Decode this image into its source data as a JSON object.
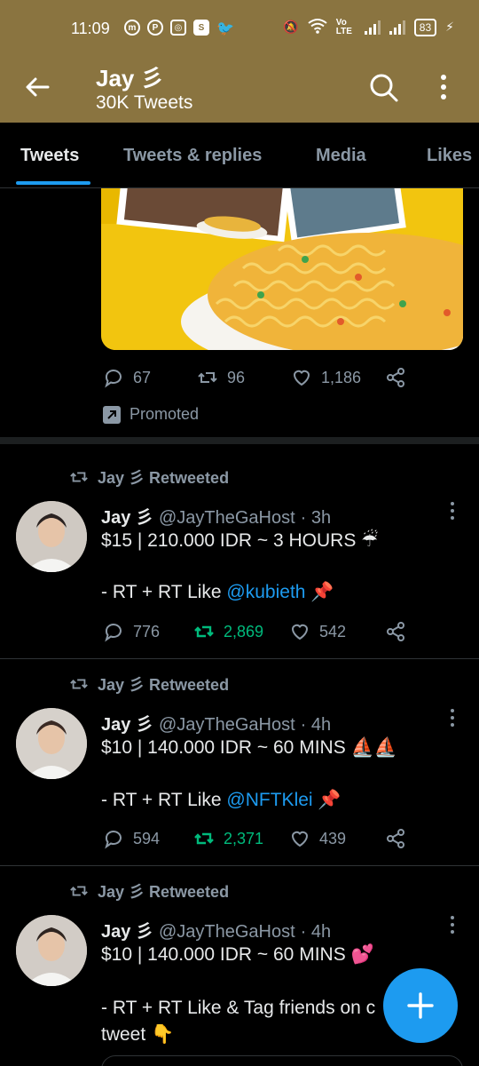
{
  "status_bar": {
    "time": "11:09",
    "network_label": "Vo LTE",
    "battery": "83"
  },
  "header": {
    "title": "Jay ⺀",
    "title_name": "Jay",
    "title_mark": "彡",
    "tweet_count": "30K Tweets"
  },
  "tabs": [
    {
      "label": "Tweets"
    },
    {
      "label": "Tweets & replies"
    },
    {
      "label": "Media"
    },
    {
      "label": "Likes"
    }
  ],
  "promo": {
    "replies": "67",
    "retweets": "96",
    "likes": "1,186",
    "promoted_label": "Promoted"
  },
  "tweets": [
    {
      "retweet_label": "Jay 彡 Retweeted",
      "name": "Jay 彡",
      "handle": "@JayTheGaHost",
      "time": "· 3h",
      "line1": "$15 | 210.000 IDR ~ 3 HOURS ☔",
      "line2_prefix": "- RT + RT Like ",
      "mention": "@kubieth",
      "line2_suffix": " 📌",
      "replies": "776",
      "retweets": "2,869",
      "likes": "542"
    },
    {
      "retweet_label": "Jay 彡 Retweeted",
      "name": "Jay 彡",
      "handle": "@JayTheGaHost",
      "time": "· 4h",
      "line1": "$10 | 140.000 IDR ~ 60 MINS ⛵⛵",
      "line2_prefix": "- RT + RT Like ",
      "mention": "@NFTKlei",
      "line2_suffix": " 📌",
      "replies": "594",
      "retweets": "2,371",
      "likes": "439"
    },
    {
      "retweet_label": "Jay 彡 Retweeted",
      "name": "Jay 彡",
      "handle": "@JayTheGaHost",
      "time": "· 4h",
      "line1": "$10 | 140.000 IDR ~ 60 MINS 💕",
      "line2": "- RT + RT Like & Tag friends on c",
      "line3": "tweet 👇"
    }
  ],
  "colors": {
    "header_bg": "#8a7440",
    "accent": "#1d9bf0",
    "retweet_green": "#00ba7c",
    "muted": "#8b98a5"
  }
}
